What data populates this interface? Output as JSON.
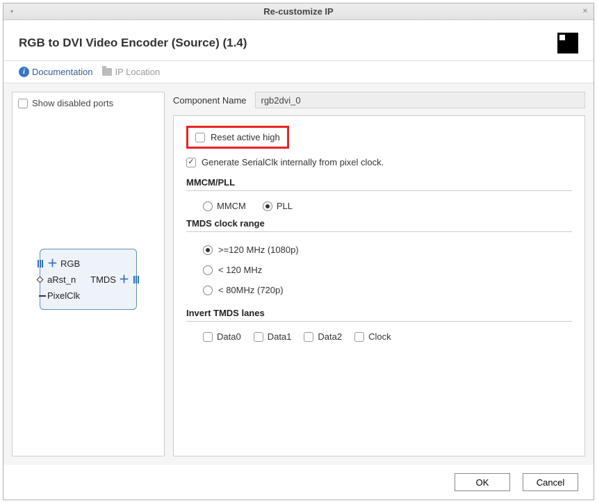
{
  "window": {
    "title": "Re-customize IP"
  },
  "header": {
    "ip_name": "RGB to DVI Video Encoder (Source) (1.4)"
  },
  "links": {
    "documentation": "Documentation",
    "ip_location": "IP Location"
  },
  "preview": {
    "show_disabled_label": "Show disabled ports",
    "show_disabled_checked": false,
    "ports": {
      "rgb": "RGB",
      "arst": "aRst_n",
      "pixelclk": "PixelClk",
      "tmds": "TMDS"
    }
  },
  "config": {
    "component_name_label": "Component Name",
    "component_name_value": "rgb2dvi_0",
    "reset_active_high": {
      "label": "Reset active high",
      "checked": false
    },
    "generate_serialclk": {
      "label": "Generate SerialClk internally from pixel clock.",
      "checked": true
    },
    "mmcm_pll": {
      "title": "MMCM/PLL",
      "options": [
        "MMCM",
        "PLL"
      ],
      "selected": "PLL"
    },
    "tmds_clock_range": {
      "title": "TMDS clock range",
      "options": [
        ">=120 MHz (1080p)",
        "< 120 MHz",
        "< 80MHz (720p)"
      ],
      "selected": ">=120 MHz (1080p)"
    },
    "invert_tmds": {
      "title": "Invert TMDS lanes",
      "lanes": [
        {
          "label": "Data0",
          "checked": false
        },
        {
          "label": "Data1",
          "checked": false
        },
        {
          "label": "Data2",
          "checked": false
        },
        {
          "label": "Clock",
          "checked": false
        }
      ]
    }
  },
  "buttons": {
    "ok": "OK",
    "cancel": "Cancel"
  }
}
